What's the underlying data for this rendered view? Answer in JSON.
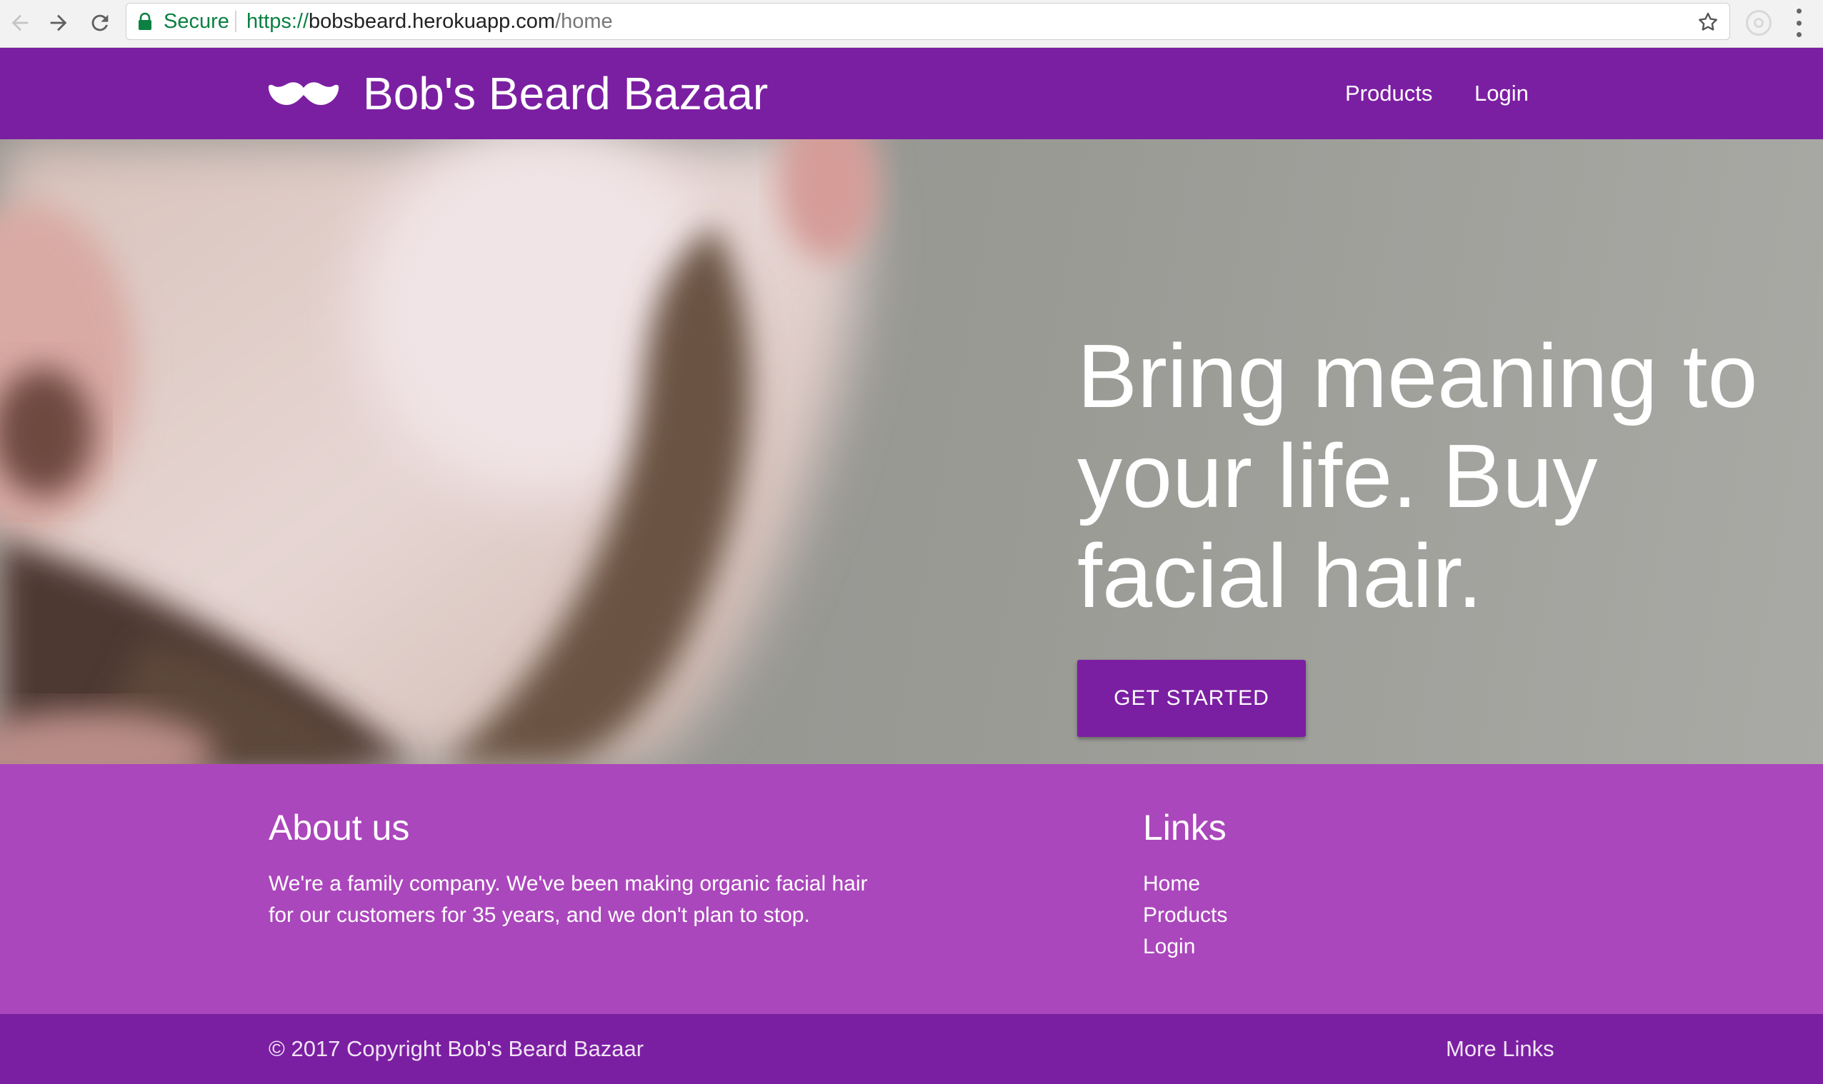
{
  "browser": {
    "secure_label": "Secure",
    "url_scheme": "https://",
    "url_host": "bobsbeard.herokuapp.com",
    "url_path": "/home",
    "icons": [
      "back-arrow-icon",
      "forward-arrow-icon",
      "reload-icon",
      "lock-icon",
      "star-icon",
      "extension-icon",
      "menu-dots-icon"
    ]
  },
  "header": {
    "brand": "Bob's Beard Bazaar",
    "logo_icon": "mustache-icon",
    "nav": [
      {
        "label": "Products"
      },
      {
        "label": "Login"
      }
    ]
  },
  "hero": {
    "headline": "Bring meaning to your life. Buy facial hair.",
    "cta_label": "GET STARTED"
  },
  "footer": {
    "about": {
      "title": "About us",
      "text": "We're a family company. We've been making organic facial hair for our customers for 35 years, and we don't plan to stop."
    },
    "links": {
      "title": "Links",
      "items": [
        {
          "label": "Home"
        },
        {
          "label": "Products"
        },
        {
          "label": "Login"
        }
      ]
    },
    "copyright": "© 2017 Copyright Bob's Beard Bazaar",
    "more_links": "More Links"
  },
  "colors": {
    "primary": "#7b1fa2",
    "footer_bg": "#ab47bc",
    "secure_green": "#0b8043"
  }
}
